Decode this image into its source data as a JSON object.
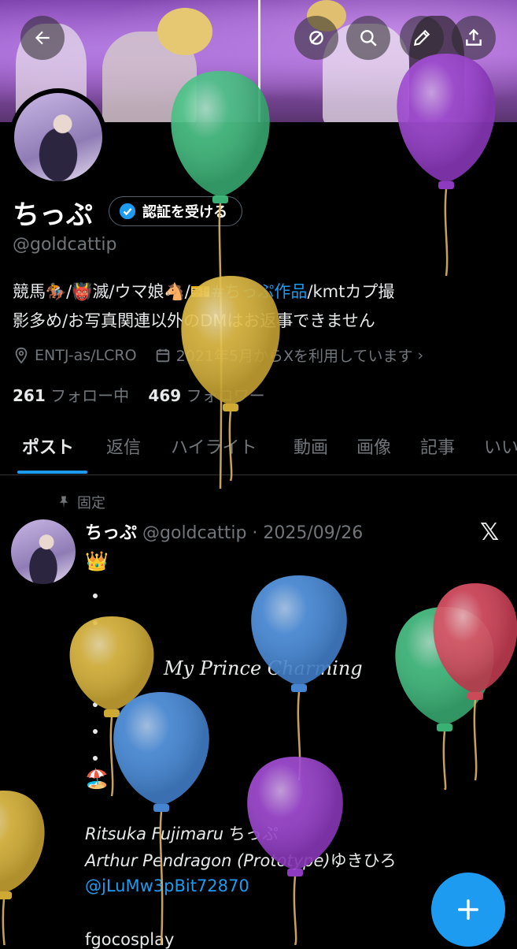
{
  "header": {
    "back_icon": "arrow-left-icon",
    "actions": [
      "refresh-icon",
      "search-icon",
      "edit-icon",
      "share-icon"
    ]
  },
  "profile": {
    "name": "ちっぷ",
    "verify_button": "認証を受ける",
    "handle": "@goldcattip",
    "bio_line1_prefix": "競馬🏇/👹滅/ウマ娘🐴/🎫",
    "bio_line1_link": "#ちっぷ作品",
    "bio_line1_suffix": "/kmtカプ撮",
    "bio_line2": "影多め/お写真関連以外のDMはお返事できません",
    "location": "ENTJ-as/LCRO",
    "joined": "2021年5月からXを利用しています",
    "following_count": "261",
    "following_label": "フォロー中",
    "followers_count": "469",
    "followers_label": "フォロワー"
  },
  "tabs": [
    "ポスト",
    "返信",
    "ハイライト",
    "動画",
    "画像",
    "記事",
    "いい"
  ],
  "active_tab": "ポスト",
  "post": {
    "pinned_label": "固定",
    "author_name": "ちっぷ",
    "author_meta": "@goldcattip · 2025/09/26",
    "crown": "👑",
    "title_line": "My Prince Charming",
    "beach": "🏖️",
    "credit1_en": "Ritsuka Fujimaru",
    "credit1_jp": "ちっぷ",
    "credit2_en": "Arthur Pendragon (Prototype)",
    "credit2_jp": "ゆきひろ",
    "mention": "@jLuMw3pBit72870",
    "tag": "fgocosplay"
  },
  "compose": {
    "icon": "plus-icon"
  },
  "colors": {
    "accent": "#1d9bf0",
    "background": "#000000",
    "muted": "#71767b"
  },
  "overlay": {
    "type": "balloons",
    "colors": [
      "#3fbf7f",
      "#9b3fd1",
      "#e0b93a",
      "#4a90e2",
      "#d9445a"
    ]
  }
}
